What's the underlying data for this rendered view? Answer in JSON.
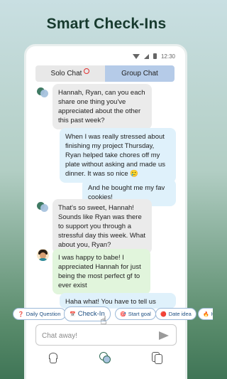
{
  "headline": "Smart Check-Ins",
  "status_bar": {
    "time": "12:30"
  },
  "tabs": [
    {
      "label": "Solo Chat",
      "selected": false,
      "has_badge": true
    },
    {
      "label": "Group Chat",
      "selected": true
    }
  ],
  "messages": [
    {
      "sender": "ai",
      "text": "Hannah, Ryan, can you each share one thing you've appreciated about the other this past week?"
    },
    {
      "sender": "ryan",
      "text": "When I was really stressed about finishing my project Thursday, Ryan helped take chores off my plate without asking and made us dinner. It was so nice 🥲"
    },
    {
      "sender": "ryan",
      "text": "And he bought me my fav cookies!"
    },
    {
      "sender": "ai",
      "text": "That's so sweet, Hannah! Sounds like Ryan was there to support you through a stressful day this week. What about you, Ryan?"
    },
    {
      "sender": "hannah",
      "text": "I was happy to babe! I appreciated Hannah for just being the most perfect gf to ever exist"
    },
    {
      "sender": "ryan",
      "text": "Haha what! You have to tell us"
    }
  ],
  "chips": [
    {
      "icon": "❓",
      "label": "Daily Question"
    },
    {
      "icon": "📅",
      "label": "Check-In"
    },
    {
      "icon": "🎯",
      "label": "Start goal"
    },
    {
      "icon": "🔴",
      "label": "Date idea"
    },
    {
      "icon": "🔥",
      "label": "Ho"
    }
  ],
  "composer": {
    "placeholder": "Chat away!"
  },
  "nav": [
    "plant-icon",
    "chat-icon",
    "people-icon"
  ],
  "colors": {
    "tab_selected": "#b5cbe8",
    "ai_bubble": "#ebebeb",
    "user_bubble": "#dff1fb",
    "partner_bubble": "#e1f5dc",
    "brand_green": "#3f7a63"
  }
}
